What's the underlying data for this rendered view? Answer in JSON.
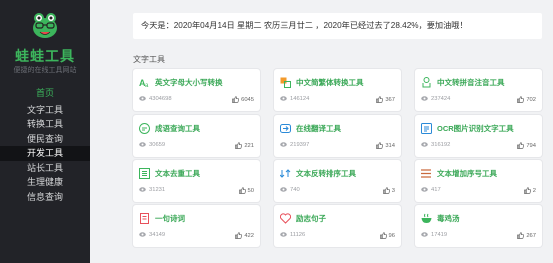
{
  "sidebar": {
    "brand": "蛙蛙工具",
    "tagline": "便捷的在线工具网站",
    "nav": [
      {
        "label": "首页",
        "state": "home"
      },
      {
        "label": "文字工具",
        "state": "normal"
      },
      {
        "label": "转换工具",
        "state": "normal"
      },
      {
        "label": "便民查询",
        "state": "normal"
      },
      {
        "label": "开发工具",
        "state": "active"
      },
      {
        "label": "站长工具",
        "state": "normal"
      },
      {
        "label": "生理健康",
        "state": "normal"
      },
      {
        "label": "信息查询",
        "state": "normal"
      }
    ]
  },
  "date_banner": "今天是：2020年04月14日 星期二 农历三月廿二 ，2020年已经过去了28.42%，要加油哦！",
  "section_title": "文字工具",
  "accent_color": "#3cb55c",
  "tools": [
    {
      "name": "英文字母大小写转换",
      "icon": "letter-case-icon",
      "views": "4304698",
      "likes": "6045"
    },
    {
      "name": "中文简繁体转换工具",
      "icon": "chinese-convert-icon",
      "views": "146124",
      "likes": "367"
    },
    {
      "name": "中文转拼音注音工具",
      "icon": "pinyin-icon",
      "views": "237424",
      "likes": "702"
    },
    {
      "name": "成语查询工具",
      "icon": "idiom-search-icon",
      "views": "30659",
      "likes": "221"
    },
    {
      "name": "在线翻译工具",
      "icon": "translate-icon",
      "views": "219397",
      "likes": "314"
    },
    {
      "name": "OCR图片识别文字工具",
      "icon": "ocr-icon",
      "views": "316192",
      "likes": "794"
    },
    {
      "name": "文本去重工具",
      "icon": "dedupe-icon",
      "views": "31231",
      "likes": "50"
    },
    {
      "name": "文本反转排序工具",
      "icon": "reverse-icon",
      "views": "740",
      "likes": "3"
    },
    {
      "name": "文本增加序号工具",
      "icon": "numbering-icon",
      "views": "417",
      "likes": "2"
    },
    {
      "name": "一句诗词",
      "icon": "poem-icon",
      "views": "34149",
      "likes": "422"
    },
    {
      "name": "励志句子",
      "icon": "heart-icon",
      "views": "11126",
      "likes": "96"
    },
    {
      "name": "毒鸡汤",
      "icon": "soup-icon",
      "views": "17419",
      "likes": "267"
    }
  ]
}
